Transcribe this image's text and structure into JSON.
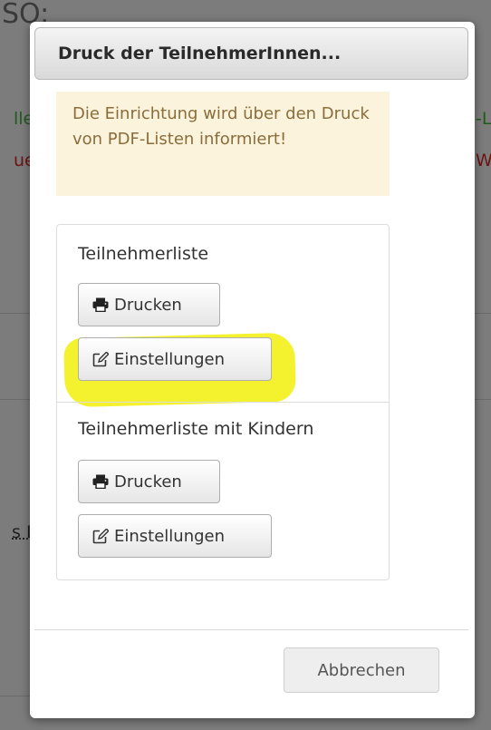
{
  "background": {
    "title_fragment": "SO:",
    "left_fragment_1": "lle",
    "left_fragment_2": "ueb",
    "left_fragment_3": "s D",
    "right_fragment_1": "-L",
    "right_fragment_2": "W"
  },
  "dialog": {
    "title": "Druck der TeilnehmerInnen...",
    "alert": "Die Einrichtung wird über den Druck von PDF-Listen informiert!",
    "sections": [
      {
        "title": "Teilnehmerliste",
        "print_label": "Drucken",
        "settings_label": "Einstellungen"
      },
      {
        "title": "Teilnehmerliste mit Kindern",
        "print_label": "Drucken",
        "settings_label": "Einstellungen"
      }
    ],
    "cancel_label": "Abbrechen"
  },
  "colors": {
    "alert_bg": "#fbf3dc",
    "alert_text": "#8a6d3b",
    "highlight": "#f2ef00"
  },
  "icons": {
    "print": "printer-icon",
    "settings": "edit-icon"
  }
}
